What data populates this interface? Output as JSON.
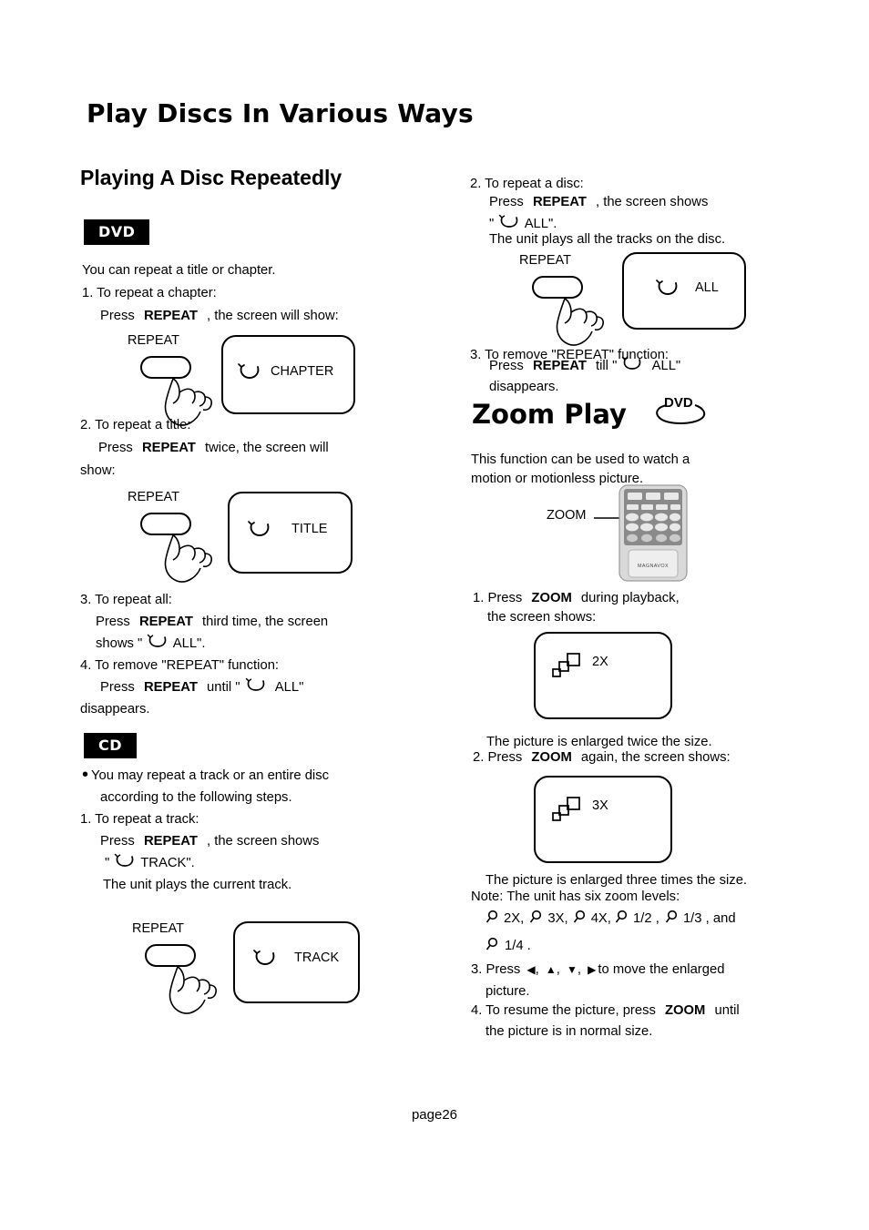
{
  "document": {
    "main_title": "Play Discs In Various Ways",
    "page_number": "page26"
  },
  "left_column": {
    "section_title": "Playing A Disc Repeatedly",
    "dvd_badge": "DVD",
    "cd_badge": "CD",
    "dvd_intro": "You can repeat a title or chapter.",
    "dvd_steps": {
      "s1_head": "1.  To repeat a chapter:",
      "s1_body_pre": "Press",
      "s1_body_key": "REPEAT",
      "s1_body_post": ", the screen will show:",
      "s2_head": "2. To repeat a title:",
      "s2_body_pre": "Press",
      "s2_body_key": "REPEAT",
      "s2_body_post": "twice,  the screen will",
      "s2_body_line2": "show:",
      "s3_head": "3. To repeat all:",
      "s3_body_pre": "Press",
      "s3_body_key": "REPEAT",
      "s3_body_post": "third time, the screen",
      "s3_line2_pre": "shows \"",
      "s3_line2_post": "ALL\".",
      "s4_head": "4. To remove \"REPEAT\" function:",
      "s4_body_pre": "Press",
      "s4_body_key": "REPEAT",
      "s4_body_mid": "until \"",
      "s4_body_post": "ALL\"",
      "s4_line2": "disappears."
    },
    "cd_steps": {
      "bullet_line1": "You may repeat a track or an entire disc",
      "bullet_line2": "according to the following steps.",
      "s1_head": "1. To repeat a track:",
      "s1_body_pre": "Press",
      "s1_body_key": "REPEAT",
      "s1_body_post": ", the screen shows",
      "s1_line2_pre": "\"",
      "s1_line2_post": "TRACK\".",
      "s1_line3": "The unit plays the current track."
    },
    "button_caption": "REPEAT",
    "screens": [
      {
        "name": "chapter",
        "label": "CHAPTER",
        "icon": "repeat-loop-icon"
      },
      {
        "name": "title",
        "label": "TITLE",
        "icon": "repeat-loop-icon"
      },
      {
        "name": "track",
        "label": "TRACK",
        "icon": "repeat-loop-icon"
      }
    ]
  },
  "right_column": {
    "dvd_cont": {
      "s2_head": "2. To repeat a disc:",
      "s2_body_pre": "Press",
      "s2_body_key": "REPEAT",
      "s2_body_post": ", the screen shows",
      "s2_line2_pre": "\"",
      "s2_line2_post": "ALL\".",
      "s2_line3": "The unit plays all the tracks on the disc.",
      "s3_head": "3. To remove \"REPEAT\" function:",
      "s3_body_pre": "Press",
      "s3_body_key": "REPEAT",
      "s3_body_mid": "till \"",
      "s3_body_post": "ALL\"",
      "s3_line2": "disappears."
    },
    "button_caption": "REPEAT",
    "all_screen": {
      "label": "ALL",
      "icon": "repeat-loop-icon"
    },
    "zoom_section": {
      "title": "Zoom Play",
      "dvd_badge": "DVD",
      "intro_line1": "This  function  can  be  used  to  watch  a",
      "intro_line2": "motion or motionless picture.",
      "callout": "ZOOM",
      "remote_brand": "MAGNAVOX",
      "s1_pre": "1. Press",
      "s1_key": "ZOOM",
      "s1_post": "during playback,",
      "s1_line2": "the screen shows:",
      "s1_result": "The picture is enlarged twice the size.",
      "s2_pre": "2. Press",
      "s2_key": "ZOOM",
      "s2_post": "again, the screen shows:",
      "s2_result": "The picture is enlarged three times the size.",
      "note_head": "Note: The unit has six zoom levels:",
      "levels_line1": [
        "2X,",
        "3X,",
        "4X,",
        "1/2 ,",
        "1/3 , and"
      ],
      "levels_line2": [
        "1/4 ."
      ],
      "s3_pre": "3. Press",
      "s3_post": "to move the enlarged",
      "s3_line2": "picture.",
      "s4_pre": "4. To resume the picture, press",
      "s4_key": "ZOOM",
      "s4_post": "until",
      "s4_line2": "the picture is in normal size.",
      "screens": [
        {
          "name": "2x",
          "label": "2X",
          "icon": "zoom-steps-icon"
        },
        {
          "name": "3x",
          "label": "3X",
          "icon": "zoom-steps-icon"
        }
      ],
      "direction_keys": [
        "left-triangle-icon",
        "up-triangle-icon",
        "down-triangle-icon",
        "right-triangle-icon"
      ]
    }
  },
  "colors": {
    "ink": "#000000",
    "paper": "#ffffff",
    "remote_body": "#d9d9d9",
    "remote_panel": "#8a8a8a",
    "remote_button": "#e8e8e8"
  }
}
